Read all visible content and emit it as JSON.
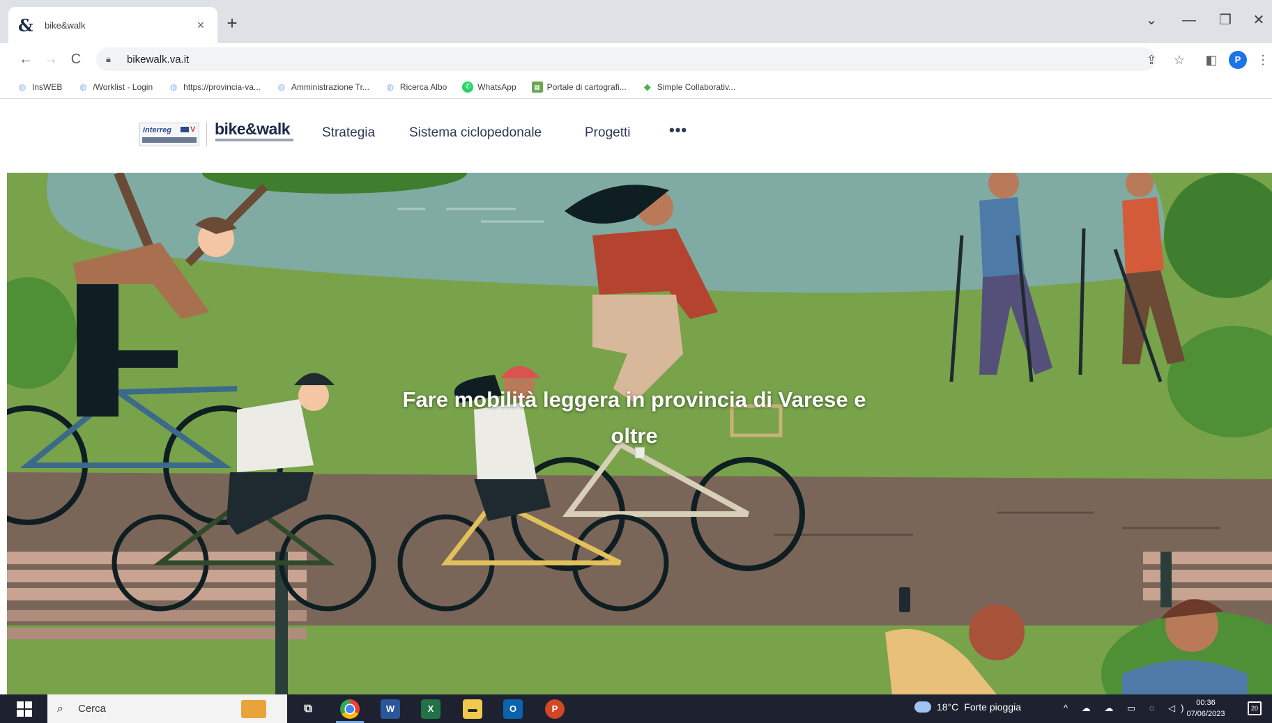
{
  "browser": {
    "tab_title": "bike&walk",
    "tab_favicon": "ampersand-icon",
    "tab_close": "×",
    "new_tab": "+",
    "window_controls": {
      "dropdown": "⌄",
      "minimize": "—",
      "maximize": "❐",
      "close": "✕"
    },
    "nav": {
      "back": "←",
      "forward": "→",
      "reload": "C"
    },
    "url": "bikewalk.va.it",
    "toolbar_icons": {
      "share": "⇪",
      "star": "☆",
      "sidepanel": "◧",
      "menu": "⋮"
    },
    "profile_initial": "P",
    "bookmarks": [
      {
        "label": "InsWEB",
        "icon": "globe-icon"
      },
      {
        "label": "/Worklist - Login",
        "icon": "globe-icon"
      },
      {
        "label": "https://provincia-va...",
        "icon": "globe-icon"
      },
      {
        "label": "Amministrazione Tr...",
        "icon": "globe-icon"
      },
      {
        "label": "Ricerca Albo",
        "icon": "globe-icon"
      },
      {
        "label": "WhatsApp",
        "icon": "whatsapp-icon"
      },
      {
        "label": "Portale di cartografi...",
        "icon": "map-icon"
      },
      {
        "label": "Simple Collaborativ...",
        "icon": "collab-icon"
      }
    ]
  },
  "site": {
    "logo_interreg": "interreg",
    "logo_interreg_v": "V",
    "logo_text": "bike&walk",
    "nav": [
      {
        "label": "Strategia"
      },
      {
        "label": "Sistema ciclopedonale"
      },
      {
        "label": "Progetti"
      }
    ],
    "nav_more": "•••",
    "hero_title": "Fare mobilità leggera in provincia di Varese e oltre"
  },
  "taskbar": {
    "search_placeholder": "Cerca",
    "weather_temp": "18°C",
    "weather_desc": "Forte pioggia",
    "tray": "^ ☁ ☁ ▭ ◌ ◁)",
    "time": "00:36",
    "date": "07/06/2023",
    "notification_count": "20"
  },
  "colors": {
    "sky_lake": "#7faba3",
    "grass": "#78a34a",
    "path": "#7a6658",
    "bench": "#c9a391",
    "tree_dark": "#3f7e2e",
    "taskbar": "#1e2130"
  }
}
